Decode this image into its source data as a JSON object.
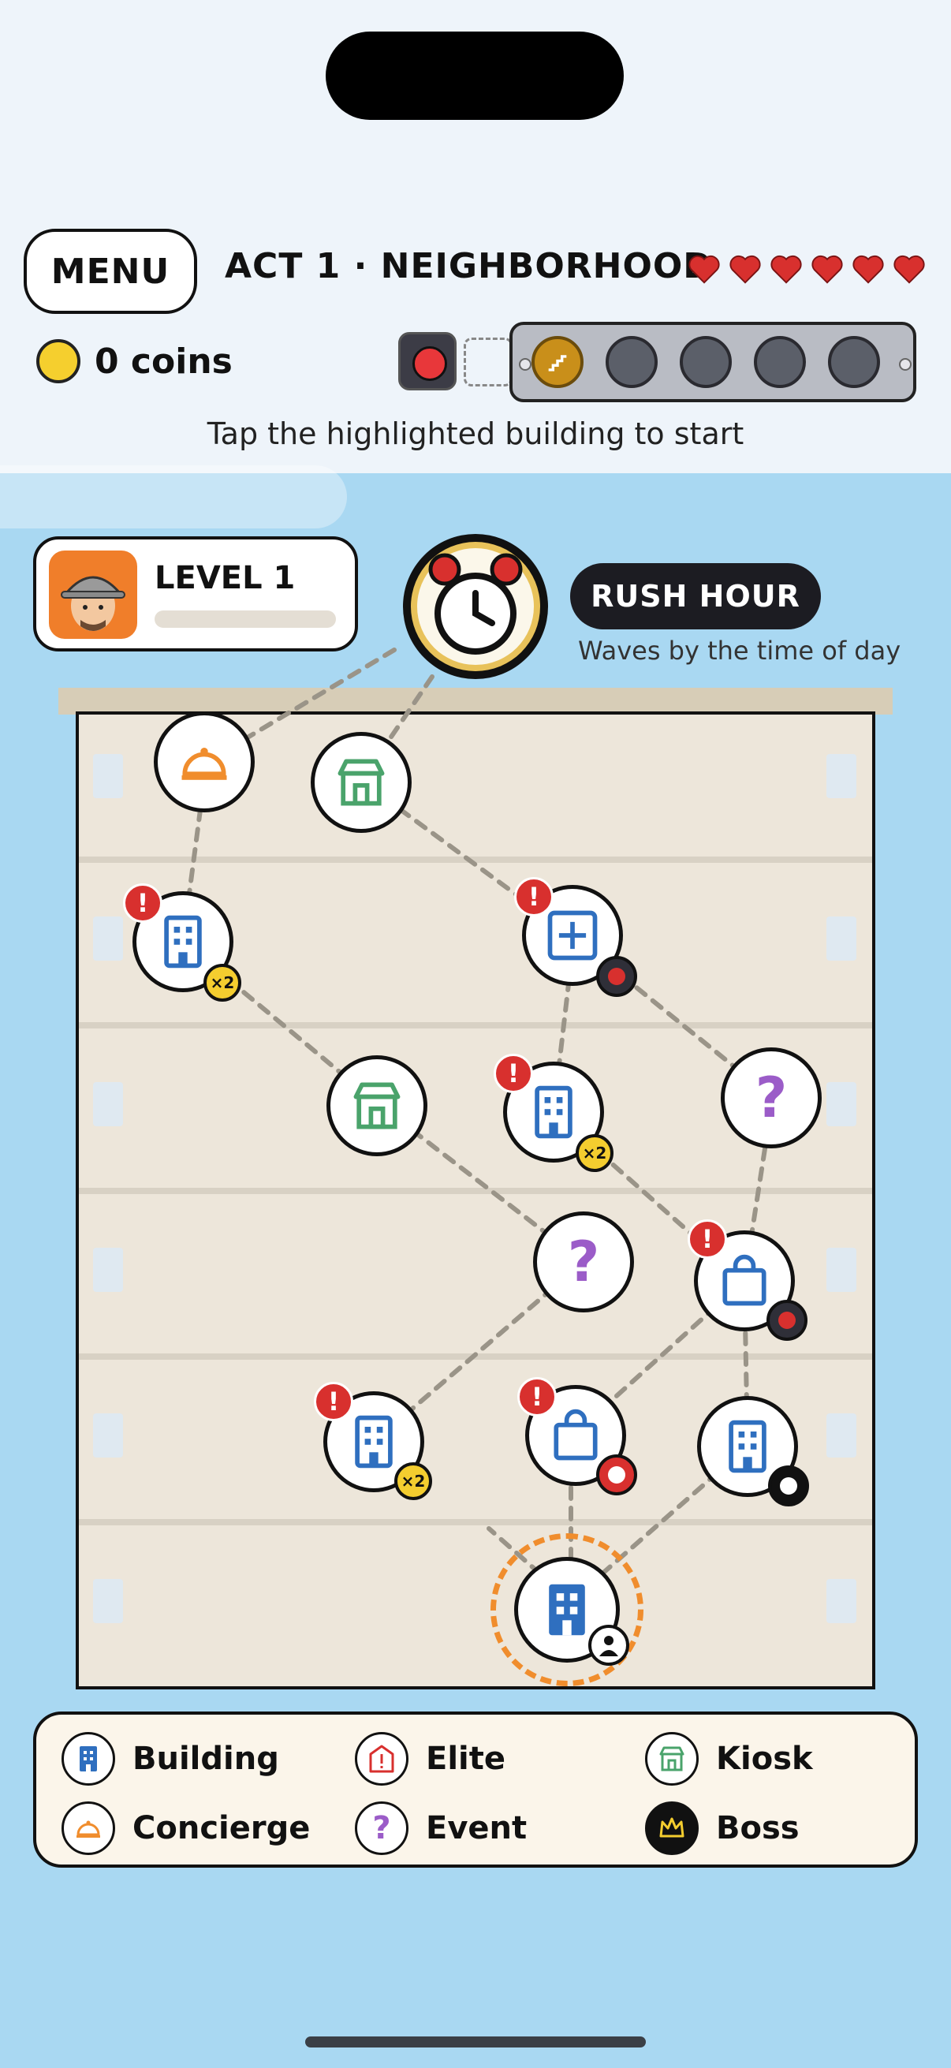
{
  "header": {
    "menu_label": "MENU",
    "act_title": "ACT 1 · NEIGHBORHOOD",
    "hearts": 6,
    "coins_label": "0 coins",
    "hint": "Tap the highlighted building to start"
  },
  "progress": {
    "total": 5,
    "active_index": 0
  },
  "level_card": {
    "title": "LEVEL 1",
    "progress": 0
  },
  "rush": {
    "badge": "RUSH HOUR",
    "subtitle": "Waves by the time of day"
  },
  "legend": {
    "building": "Building",
    "elite": "Elite",
    "kiosk": "Kiosk",
    "concierge": "Concierge",
    "event": "Event",
    "boss": "Boss"
  },
  "map": {
    "x2_label": "×2",
    "alert_label": "!",
    "event_label": "?"
  },
  "colors": {
    "building": "#2f6fbf",
    "kiosk": "#4aa36b",
    "concierge": "#f08d2d",
    "event": "#9b5cc8",
    "alert": "#d8302e",
    "heart": "#d8302e",
    "coin": "#f5cf2e",
    "sky": "#a9d8f2"
  }
}
